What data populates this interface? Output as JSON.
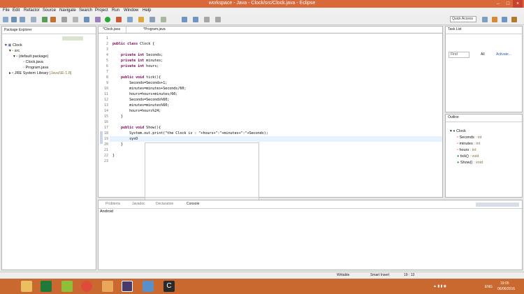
{
  "window": {
    "title": "workspace - Java - Clock/src/Clock.java - Eclipse"
  },
  "menu": [
    "File",
    "Edit",
    "Refactor",
    "Source",
    "Navigate",
    "Search",
    "Project",
    "Run",
    "Window",
    "Help"
  ],
  "quick_access": {
    "placeholder": "Quick Access"
  },
  "package_explorer": {
    "tab_label": "Package Explorer",
    "tree": [
      {
        "label": "Clock",
        "depth": 0
      },
      {
        "label": "src",
        "depth": 1
      },
      {
        "label": "(default package)",
        "depth": 2
      },
      {
        "label": "Clock.java",
        "depth": 3
      },
      {
        "label": "Program.java",
        "depth": 3
      },
      {
        "label": "JRE System Library",
        "suffix": "[JavaSE-1.8]",
        "depth": 1
      }
    ]
  },
  "editor": {
    "tabs": [
      "*Clock.java",
      "*Program.java"
    ],
    "lines": [
      "",
      "public class Clock {",
      "",
      "    private int Seconds;",
      "    private int minutes;",
      "    private int hours;",
      "",
      "    public void tick(){",
      "        Seconds=Seconds+1;",
      "        minutes=minutes+Seconds/60;",
      "        hours=hours+minutes/60;",
      "        Seconds=Seconds%60;",
      "        minutes=minutes%60;",
      "        hours=hours%24;",
      "    }",
      "",
      "    public void Show(){",
      "        System.out.print(\"the Clock is : \"+hours+\":\"+minutes+\":\"+Seconds);",
      "        sysO",
      "    }",
      "",
      "}",
      ""
    ]
  },
  "task_list": {
    "tab_label": "Task List",
    "find_placeholder": "Find",
    "all_label": "All",
    "activate_label": "Activate..."
  },
  "outline": {
    "tab_label": "Outline",
    "items": [
      {
        "label": "Clock",
        "type": "",
        "depth": 0
      },
      {
        "label": "Seconds",
        "type": ": int",
        "depth": 1
      },
      {
        "label": "minutes",
        "type": ": int",
        "depth": 1
      },
      {
        "label": "hours",
        "type": ": int",
        "depth": 1
      },
      {
        "label": "tick()",
        "type": ": void",
        "depth": 1
      },
      {
        "label": "Show()",
        "type": ": void",
        "depth": 1
      }
    ]
  },
  "bottom": {
    "tabs": [
      "Problems",
      "Javadoc",
      "Declaration",
      "Console"
    ],
    "console_text": "Android"
  },
  "status": {
    "mode": "Writable",
    "insert": "Smart Insert",
    "position": "19 : 13"
  },
  "tray": {
    "lang": "ENG",
    "time": "19:05",
    "date": "06/06/2016"
  },
  "colors": {
    "title": "#d9683b",
    "taskbar": "#c9692f",
    "keyword": "#7f0055"
  }
}
